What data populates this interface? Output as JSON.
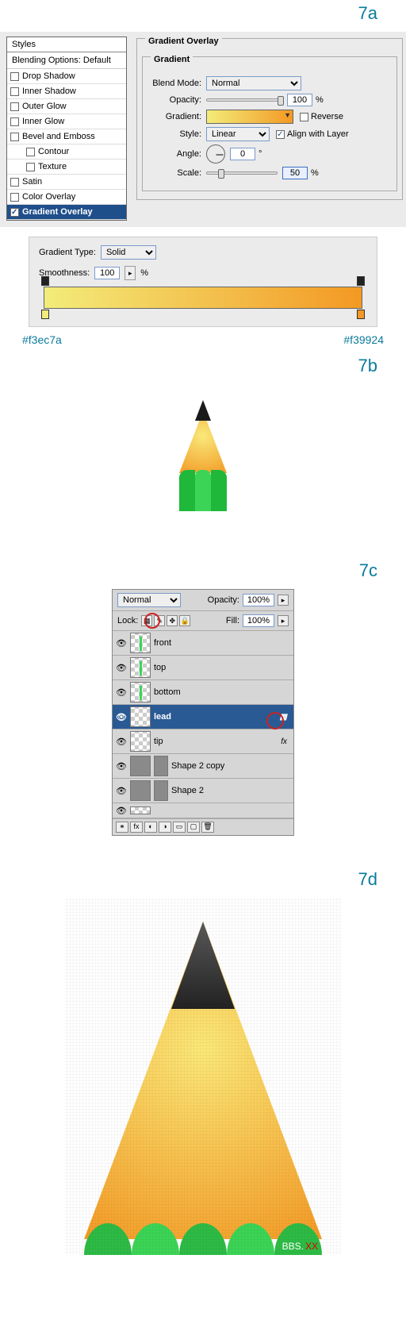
{
  "steps": {
    "a": "7a",
    "b": "7b",
    "c": "7c",
    "d": "7d"
  },
  "styles_panel": {
    "header": "Styles",
    "blending_options": "Blending Options: Default",
    "items": [
      {
        "label": "Drop Shadow",
        "checked": false,
        "sub": false
      },
      {
        "label": "Inner Shadow",
        "checked": false,
        "sub": false
      },
      {
        "label": "Outer Glow",
        "checked": false,
        "sub": false
      },
      {
        "label": "Inner Glow",
        "checked": false,
        "sub": false
      },
      {
        "label": "Bevel and Emboss",
        "checked": false,
        "sub": false
      },
      {
        "label": "Contour",
        "checked": false,
        "sub": true
      },
      {
        "label": "Texture",
        "checked": false,
        "sub": true
      },
      {
        "label": "Satin",
        "checked": false,
        "sub": false
      },
      {
        "label": "Color Overlay",
        "checked": false,
        "sub": false
      },
      {
        "label": "Gradient Overlay",
        "checked": true,
        "sub": false,
        "selected": true
      }
    ]
  },
  "gradient_overlay": {
    "legend_outer": "Gradient Overlay",
    "legend_inner": "Gradient",
    "blend_mode_label": "Blend Mode:",
    "blend_mode_value": "Normal",
    "opacity_label": "Opacity:",
    "opacity_value": "100",
    "pct": "%",
    "gradient_label": "Gradient:",
    "reverse_label": "Reverse",
    "style_label": "Style:",
    "style_value": "Linear",
    "align_label": "Align with Layer",
    "angle_label": "Angle:",
    "angle_value": "0",
    "deg": "°",
    "scale_label": "Scale:",
    "scale_value": "50"
  },
  "gradient_editor": {
    "type_label": "Gradient Type:",
    "type_value": "Solid",
    "smoothness_label": "Smoothness:",
    "smoothness_value": "100",
    "pct": "%",
    "left_hex": "#f3ec7a",
    "right_hex": "#f39924"
  },
  "layers_panel": {
    "blend_mode": "Normal",
    "opacity_label": "Opacity:",
    "opacity_value": "100%",
    "lock_label": "Lock:",
    "fill_label": "Fill:",
    "fill_value": "100%",
    "layers": [
      {
        "name": "front",
        "eye": true,
        "sel": false,
        "thumb": "barchk"
      },
      {
        "name": "top",
        "eye": true,
        "sel": false,
        "thumb": "barchk"
      },
      {
        "name": "bottom",
        "eye": true,
        "sel": false,
        "thumb": "barchk"
      },
      {
        "name": "lead",
        "eye": true,
        "sel": true,
        "thumb": "chk",
        "badge": ""
      },
      {
        "name": "tip",
        "eye": true,
        "sel": false,
        "thumb": "chk",
        "badge": "fx"
      },
      {
        "name": "Shape 2 copy",
        "eye": true,
        "sel": false,
        "thumb": "grey"
      },
      {
        "name": "Shape 2",
        "eye": true,
        "sel": false,
        "thumb": "grey"
      }
    ]
  },
  "footer": {
    "bbs": "BBS.",
    "xx": "XX"
  }
}
